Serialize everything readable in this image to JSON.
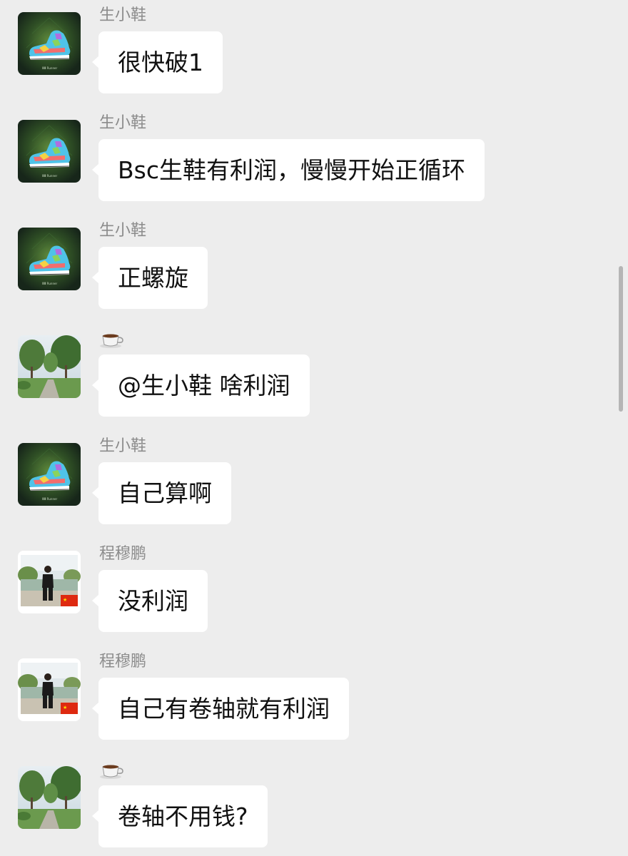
{
  "colors": {
    "background": "#ededed",
    "bubble": "#ffffff",
    "sender_name": "#8c8c8c",
    "message_text": "#111111",
    "scrollbar": "#b5b5b5"
  },
  "messages": [
    {
      "sender": "生小鞋",
      "avatar": "sneaker-avatar",
      "text": "很快破1"
    },
    {
      "sender": "生小鞋",
      "avatar": "sneaker-avatar",
      "text": "Bsc生鞋有利润，慢慢开始正循环"
    },
    {
      "sender": "生小鞋",
      "avatar": "sneaker-avatar",
      "text": "正螺旋"
    },
    {
      "sender": "",
      "sender_icon": "coffee-icon",
      "avatar": "park-path-avatar",
      "text": "@生小鞋 啥利润"
    },
    {
      "sender": "生小鞋",
      "avatar": "sneaker-avatar",
      "text": "自己算啊"
    },
    {
      "sender": "程穆鹏",
      "avatar": "person-lake-avatar",
      "text": "没利润"
    },
    {
      "sender": "程穆鹏",
      "avatar": "person-lake-avatar",
      "text": "自己有卷轴就有利润"
    },
    {
      "sender": "",
      "sender_icon": "coffee-icon",
      "avatar": "park-path-avatar",
      "text": "卷轴不用钱?"
    }
  ]
}
